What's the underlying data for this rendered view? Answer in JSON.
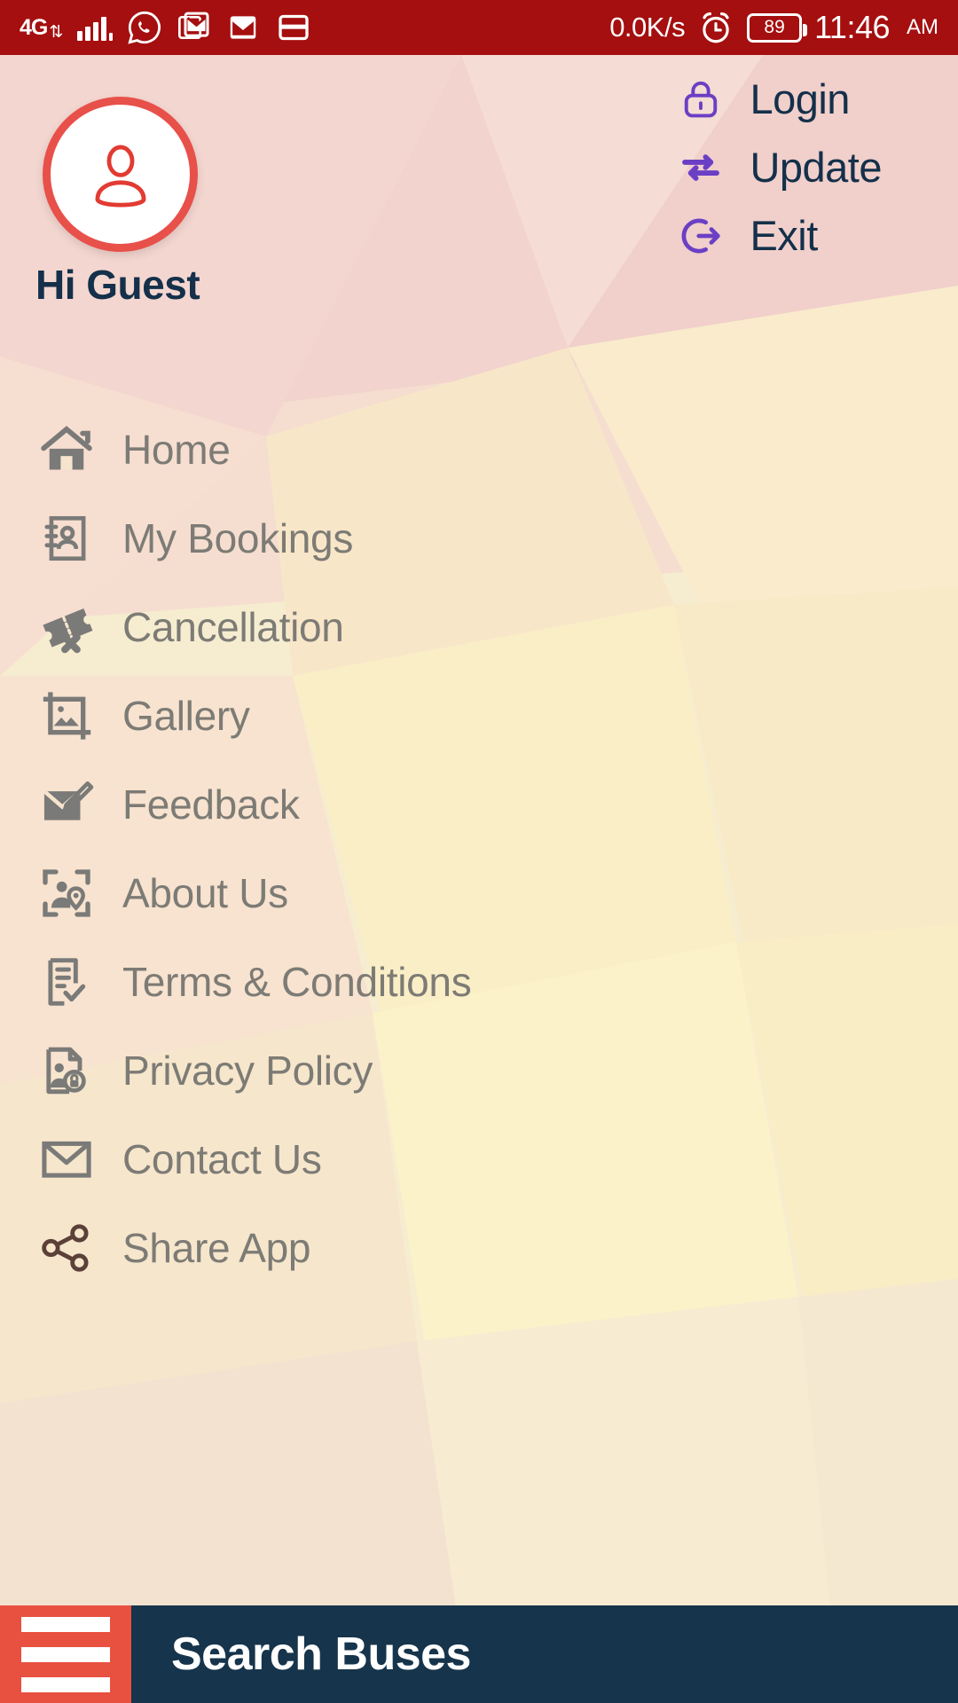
{
  "statusbar": {
    "network_type": "4G",
    "network_arrows_icon": "up-down-arrows-icon",
    "signal_icon": "signal-bars-icon",
    "app_icons": [
      "whatsapp-icon",
      "gmail-icon",
      "gmail-icon",
      "card-icon"
    ],
    "data_speed": "0.0K/s",
    "alarm_icon": "alarm-clock-icon",
    "battery_level": "89",
    "time": "11:46",
    "meridiem": "AM"
  },
  "header": {
    "avatar_icon": "user-avatar-icon",
    "greeting": "Hi Guest",
    "actions": [
      {
        "label": "Login",
        "icon": "lock-icon"
      },
      {
        "label": "Update",
        "icon": "swap-arrows-icon"
      },
      {
        "label": "Exit",
        "icon": "logout-icon"
      }
    ]
  },
  "menu": {
    "items": [
      {
        "label": "Home",
        "icon": "home-icon"
      },
      {
        "label": "My Bookings",
        "icon": "contact-book-icon"
      },
      {
        "label": "Cancellation",
        "icon": "ticket-cancel-icon"
      },
      {
        "label": "Gallery",
        "icon": "image-crop-icon"
      },
      {
        "label": "Feedback",
        "icon": "envelope-pencil-icon"
      },
      {
        "label": "About Us",
        "icon": "person-location-frame-icon"
      },
      {
        "label": "Terms & Conditions",
        "icon": "document-check-icon"
      },
      {
        "label": "Privacy Policy",
        "icon": "document-person-lock-icon"
      },
      {
        "label": "Contact Us",
        "icon": "envelope-outline-icon"
      },
      {
        "label": "Share App",
        "icon": "share-nodes-icon"
      }
    ]
  },
  "bottombar": {
    "menu_icon": "hamburger-menu-icon",
    "title": "Search Buses"
  },
  "colors": {
    "statusbar_bg": "#a50f0f",
    "accent_red": "#e8503f",
    "avatar_border": "#e8504a",
    "navy": "#16344b",
    "purple": "#6b3fc4",
    "menu_text": "#7d7b75"
  }
}
